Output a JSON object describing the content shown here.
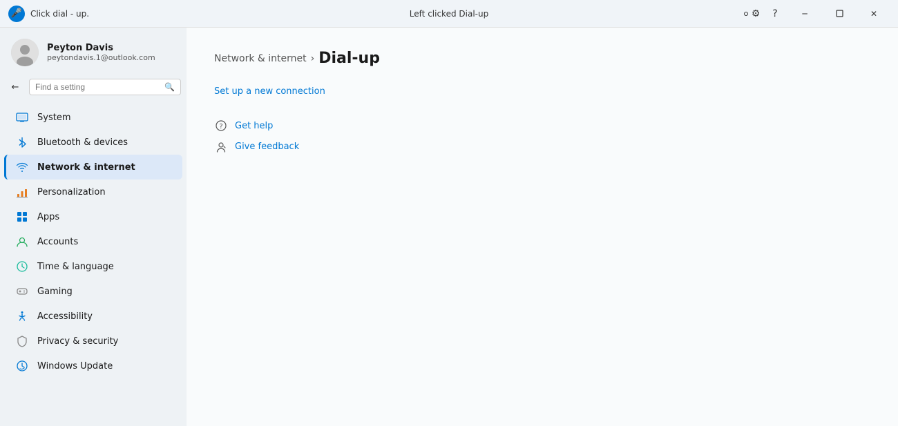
{
  "titlebar": {
    "app_icon": "🎤",
    "app_title": "Click dial - up.",
    "center_text": "Left clicked Dial-up",
    "settings_icon": "⚙",
    "help_icon": "?",
    "minimize_icon": "─",
    "restore_icon": "❐",
    "close_icon": "✕"
  },
  "sidebar": {
    "user": {
      "name": "Peyton Davis",
      "email": "peytondavis.1@outlook.com"
    },
    "search": {
      "placeholder": "Find a setting"
    },
    "nav_items": [
      {
        "id": "system",
        "label": "System",
        "icon": "system"
      },
      {
        "id": "bluetooth",
        "label": "Bluetooth & devices",
        "icon": "bluetooth"
      },
      {
        "id": "network",
        "label": "Network & internet",
        "icon": "network",
        "active": true
      },
      {
        "id": "personalization",
        "label": "Personalization",
        "icon": "personalization"
      },
      {
        "id": "apps",
        "label": "Apps",
        "icon": "apps"
      },
      {
        "id": "accounts",
        "label": "Accounts",
        "icon": "accounts"
      },
      {
        "id": "time",
        "label": "Time & language",
        "icon": "time"
      },
      {
        "id": "gaming",
        "label": "Gaming",
        "icon": "gaming"
      },
      {
        "id": "accessibility",
        "label": "Accessibility",
        "icon": "accessibility"
      },
      {
        "id": "privacy",
        "label": "Privacy & security",
        "icon": "privacy"
      },
      {
        "id": "update",
        "label": "Windows Update",
        "icon": "update"
      }
    ]
  },
  "content": {
    "breadcrumb_parent": "Network & internet",
    "breadcrumb_sep": ">",
    "breadcrumb_current": "Dial-up",
    "setup_link": "Set up a new connection",
    "help_items": [
      {
        "id": "get-help",
        "label": "Get help",
        "icon": "help"
      },
      {
        "id": "feedback",
        "label": "Give feedback",
        "icon": "feedback"
      }
    ]
  }
}
